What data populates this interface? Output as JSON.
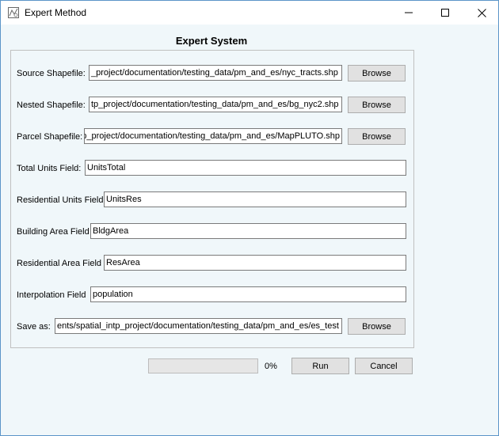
{
  "window": {
    "title": "Expert Method",
    "controls": {
      "minimize": "minimize-icon",
      "maximize": "maximize-icon",
      "close": "close-icon"
    }
  },
  "heading": "Expert System",
  "rows": {
    "source": {
      "label": "Source Shapefile:",
      "value": "_project/documentation/testing_data/pm_and_es/nyc_tracts.shp",
      "button": "Browse"
    },
    "nested": {
      "label": "Nested Shapefile:",
      "value": "tp_project/documentation/testing_data/pm_and_es/bg_nyc2.shp",
      "button": "Browse"
    },
    "parcel": {
      "label": "Parcel Shapefile:",
      "value": "p_project/documentation/testing_data/pm_and_es/MapPLUTO.shp",
      "button": "Browse"
    },
    "total_units": {
      "label": "Total Units Field:",
      "value": "UnitsTotal"
    },
    "residential_units": {
      "label": "Residential Units Field",
      "value": "UnitsRes"
    },
    "building_area": {
      "label": "Building Area Field",
      "value": "BldgArea"
    },
    "residential_area": {
      "label": "Residential Area Field",
      "value": "ResArea"
    },
    "interpolation": {
      "label": "Interpolation Field",
      "value": "population"
    },
    "save_as": {
      "label": "Save as:",
      "value": "ents/spatial_intp_project/documentation/testing_data/pm_and_es/es_test",
      "button": "Browse"
    }
  },
  "progress": {
    "value": 0,
    "label": "0%"
  },
  "actions": {
    "run": "Run",
    "cancel": "Cancel"
  }
}
